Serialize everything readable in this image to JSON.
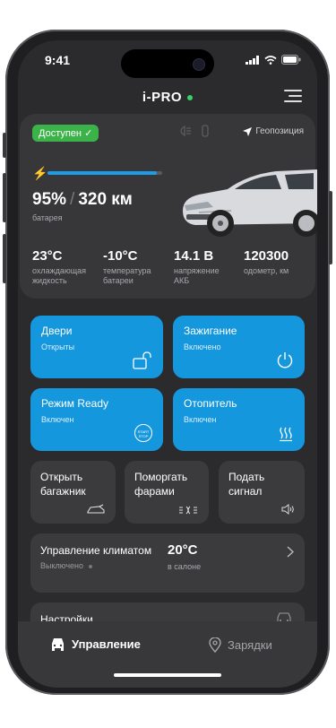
{
  "status_bar": {
    "time": "9:41"
  },
  "header": {
    "logo": "i-PRO"
  },
  "car_status": {
    "availability": "Доступен",
    "geo_label": "Геопозиция",
    "battery_percent": "95%",
    "battery_fraction": 0.95,
    "range": "320 км",
    "battery_caption": "батарея"
  },
  "stats": [
    {
      "value": "23°C",
      "label": "охлаждающая жидкость"
    },
    {
      "value": "-10°C",
      "label": "температура батареи"
    },
    {
      "value": "14.1 В",
      "label": "напряжение АКБ"
    },
    {
      "value": "120300",
      "label": "одометр, км"
    }
  ],
  "controls": {
    "doors": {
      "title": "Двери",
      "state": "Открыты"
    },
    "ignition": {
      "title": "Зажигание",
      "state": "Включено"
    },
    "ready": {
      "title": "Режим Ready",
      "state": "Включен",
      "icon_text": "START STOP"
    },
    "heater": {
      "title": "Отопитель",
      "state": "Включен"
    }
  },
  "actions": {
    "trunk": "Открыть багажник",
    "lights": "Поморгать фарами",
    "horn": "Подать сигнал"
  },
  "climate": {
    "title": "Управление климатом",
    "state": "Выключено",
    "temp": "20°C",
    "temp_caption": "в салоне"
  },
  "settings": {
    "title": "Настройки"
  },
  "bottom_nav": {
    "control": "Управление",
    "charging": "Зарядки"
  },
  "colors": {
    "accent": "#1597dd",
    "available": "#3cb24a",
    "background": "#2b2b2d",
    "tile": "#3b3b3e"
  }
}
